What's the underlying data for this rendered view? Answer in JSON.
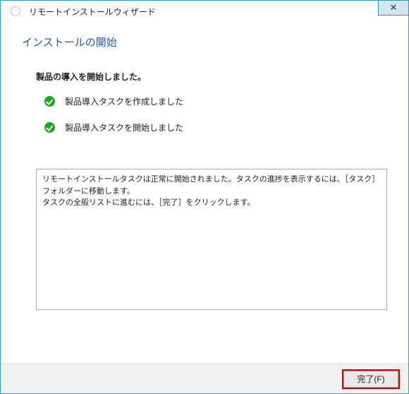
{
  "titlebar": {
    "title": "リモートインストールウィザード",
    "close_glyph": "✕"
  },
  "section_title": "インストールの開始",
  "status": {
    "heading": "製品の導入を開始しました。",
    "items": [
      {
        "label": "製品導入タスクを作成しました"
      },
      {
        "label": "製品導入タスクを開始しました"
      }
    ]
  },
  "log": {
    "line1": "リモートインストールタスクは正常に開始されました。タスクの進捗を表示するには、［タスク］フォルダーに移動します。",
    "line2": "タスクの全般リストに進むには、［完了］をクリックします。"
  },
  "footer": {
    "finish_label": "完了(F)"
  }
}
